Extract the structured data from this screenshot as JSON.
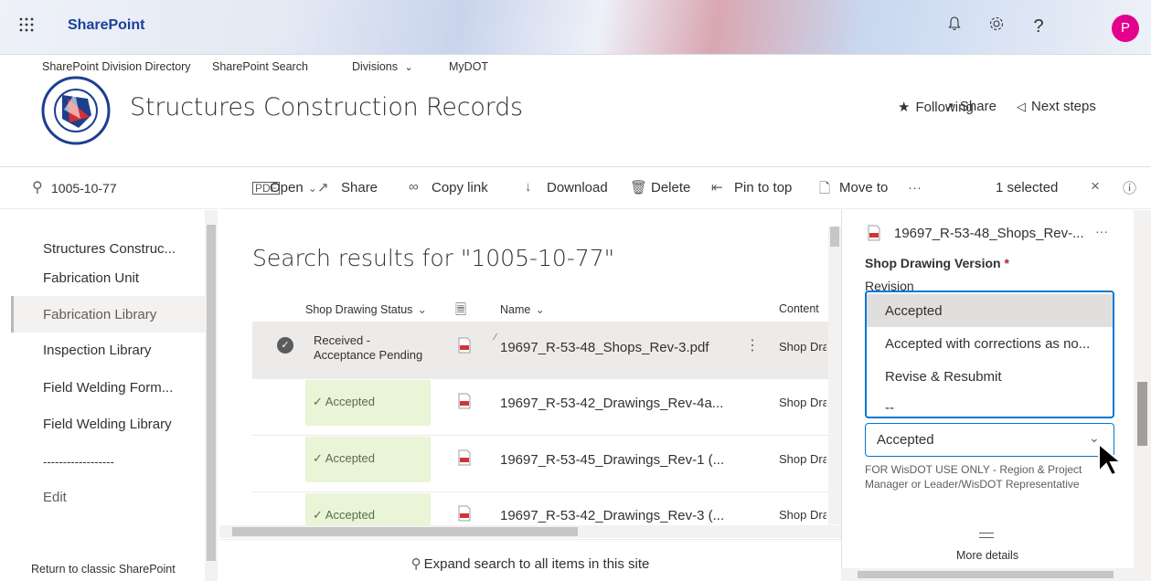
{
  "suite_bar": {
    "brand": "SharePoint",
    "waffle_icon": "waffle-icon",
    "avatar_initial": "P",
    "avatar_color": "#e3008c"
  },
  "hub_nav": {
    "items": [
      "SharePoint Division Directory",
      "SharePoint Search",
      "Divisions",
      "MyDOT"
    ]
  },
  "site": {
    "title": "Structures Construction Records",
    "following": "Following",
    "share": "Share",
    "next_steps": "Next steps"
  },
  "search": {
    "value": "1005-10-77"
  },
  "left_nav": {
    "items": [
      "Structures Construc...",
      "Fabrication Unit",
      "Fabrication Library",
      "Inspection Library",
      "Field Welding Form...",
      "Field Welding Library",
      "------------------",
      "Edit"
    ],
    "selected": "Fabrication Library",
    "footer": "Return to classic SharePoint"
  },
  "command_bar": {
    "open": "Open",
    "share": "Share",
    "copy_link": "Copy link",
    "download": "Download",
    "delete": "Delete",
    "pin_to_top": "Pin to top",
    "move_to": "Move to",
    "more": "···",
    "selected_count": "1 selected"
  },
  "results": {
    "title": "Search results for \"1005-10-77\"",
    "columns": {
      "status": "Shop Drawing Status",
      "name": "Name",
      "content": "Content"
    },
    "rows": [
      {
        "status": "Received - Acceptance Pending",
        "name": "19697_R-53-48_Shops_Rev-3.pdf",
        "content": "Shop Dra"
      },
      {
        "status": "✓ Accepted",
        "name": "19697_R-53-42_Drawings_Rev-4a...",
        "content": "Shop Dra"
      },
      {
        "status": "✓ Accepted",
        "name": "19697_R-53-45_Drawings_Rev-1 (...",
        "content": "Shop Dra"
      },
      {
        "status": "✓ Accepted",
        "name": "19697_R-53-42_Drawings_Rev-3 (...",
        "content": "Shop Dra"
      }
    ],
    "expand_search": "Expand search to all items in this site",
    "accent_green": "#e9f5d6"
  },
  "details_pane": {
    "file_name": "19697_R-53-48_Shops_Rev-...",
    "field_label": "Shop Drawing Version",
    "required_mark": "*",
    "sub_label": "Revision",
    "options": [
      "Accepted",
      "Accepted with corrections as no...",
      "Revise & Resubmit",
      "--"
    ],
    "selected_value": "Accepted",
    "help_text": "FOR WisDOT USE ONLY - Region & Project Manager or Leader/WisDOT Representative",
    "more_details": "More details",
    "focus_color": "#0078d4"
  }
}
